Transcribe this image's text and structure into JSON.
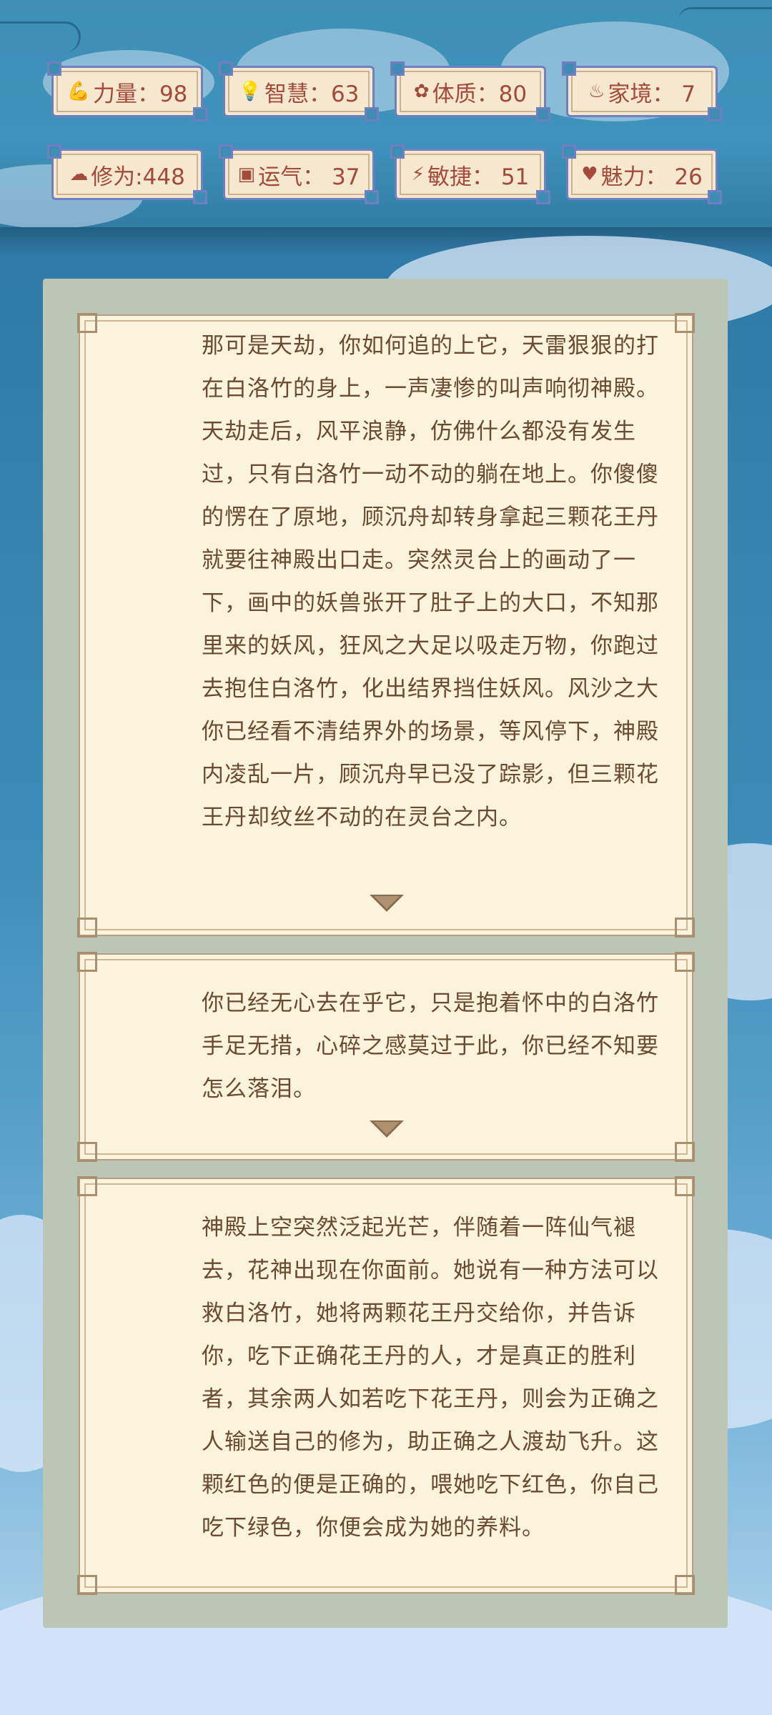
{
  "stats": [
    {
      "icon": "muscle-icon",
      "glyph": "💪",
      "label": "力量：98"
    },
    {
      "icon": "lightbulb-icon",
      "glyph": "💡",
      "label": "智慧：63"
    },
    {
      "icon": "constitution-icon",
      "glyph": "✿",
      "label": "体质：80"
    },
    {
      "icon": "family-icon",
      "glyph": "♨",
      "label": "家境： 7"
    },
    {
      "icon": "cloud-icon",
      "glyph": "☁",
      "label": "修为:448"
    },
    {
      "icon": "luck-icon",
      "glyph": "▣",
      "label": "运气： 37"
    },
    {
      "icon": "lightning-icon",
      "glyph": "⚡",
      "label": "敏捷： 51"
    },
    {
      "icon": "heart-icon",
      "glyph": "♥",
      "label": "魅力： 26"
    }
  ],
  "story": [
    {
      "text": "那可是天劫，你如何追的上它，天雷狠狠的打在白洛竹的身上，一声凄惨的叫声响彻神殿。天劫走后，风平浪静，仿佛什么都没有发生过，只有白洛竹一动不动的躺在地上。你傻傻的愣在了原地，顾沉舟却转身拿起三颗花王丹就要往神殿出口走。突然灵台上的画动了一下，画中的妖兽张开了肚子上的大口，不知那里来的妖风，狂风之大足以吸走万物，你跑过去抱住白洛竹，化出结界挡住妖风。风沙之大你已经看不清结界外的场景，等风停下，神殿内凌乱一片，顾沉舟早已没了踪影，但三颗花王丹却纹丝不动的在灵台之内。"
    },
    {
      "text": "你已经无心去在乎它，只是抱着怀中的白洛竹手足无措，心碎之感莫过于此，你已经不知要怎么落泪。"
    },
    {
      "text": "神殿上空突然泛起光芒，伴随着一阵仙气褪去，花神出现在你面前。她说有一种方法可以救白洛竹，她将两颗花王丹交给你，并告诉你，吃下正确花王丹的人，才是真正的胜利者，其余两人如若吃下花王丹，则会为正确之人输送自己的修为，助正确之人渡劫飞升。这颗红色的便是正确的，喂她吃下红色，你自己吃下绿色，你便会成为她的养料。"
    }
  ]
}
